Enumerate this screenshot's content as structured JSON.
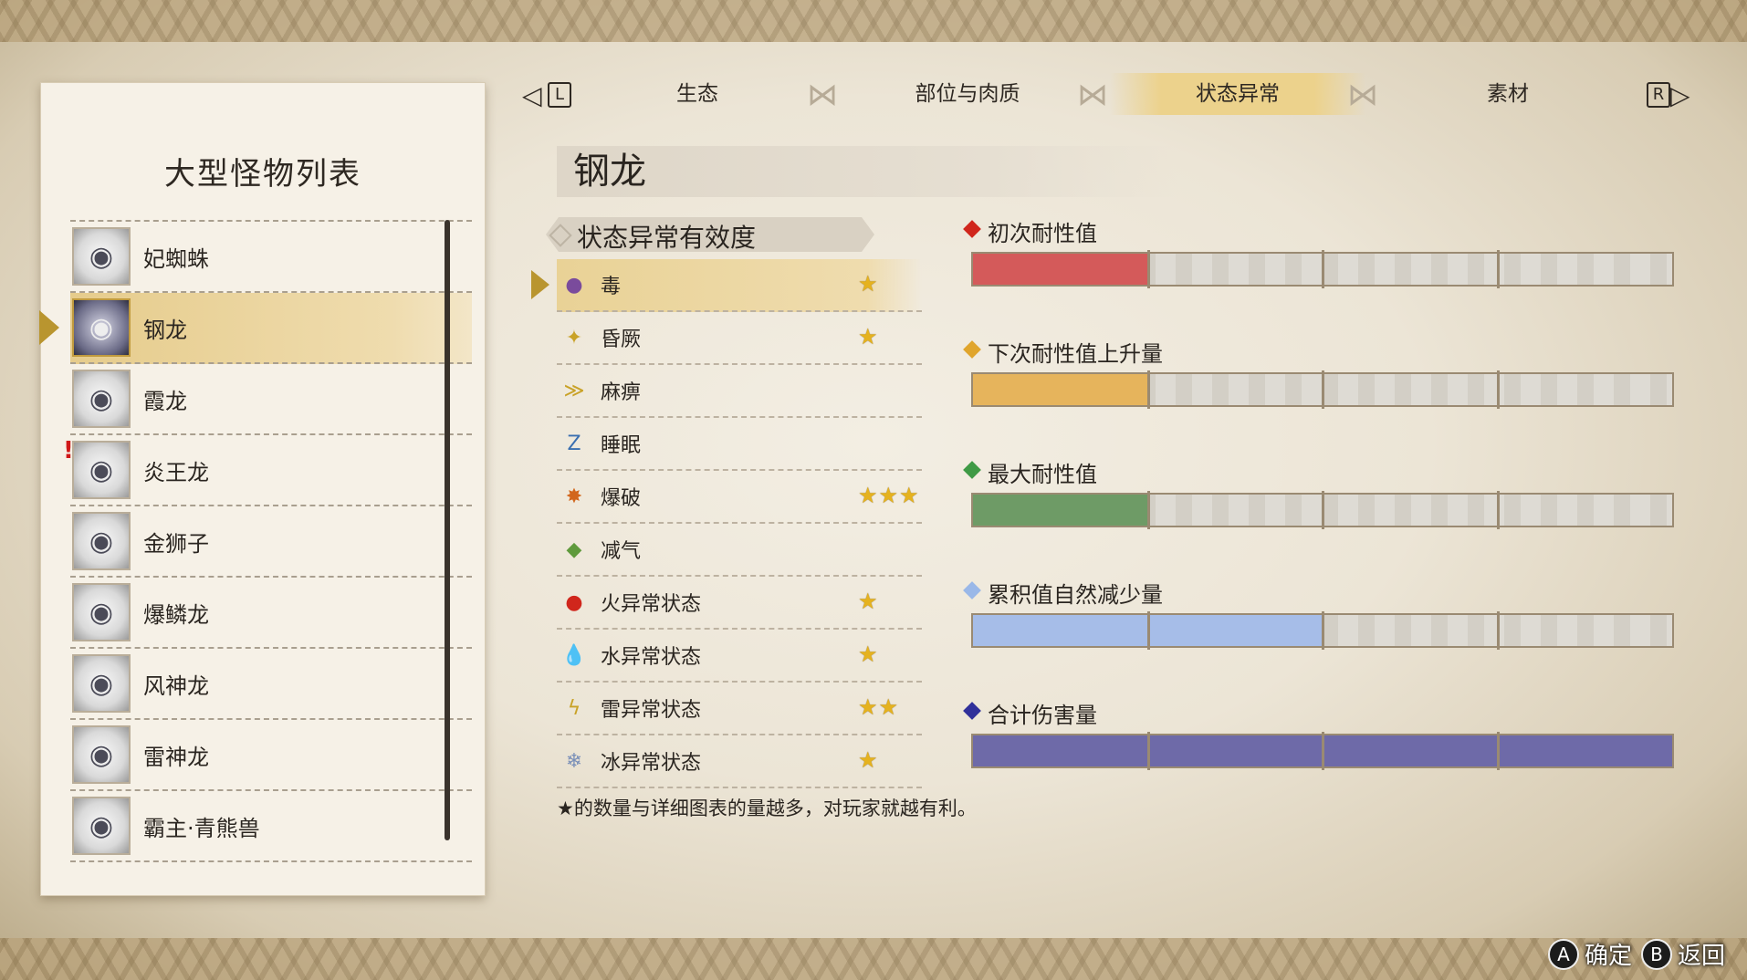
{
  "left_panel": {
    "title": "大型怪物列表",
    "monsters": [
      {
        "name": "妃蜘蛛",
        "alert": false
      },
      {
        "name": "钢龙",
        "alert": false,
        "selected": true
      },
      {
        "name": "霞龙",
        "alert": false
      },
      {
        "name": "炎王龙",
        "alert": true,
        "alert_text": "!"
      },
      {
        "name": "金狮子",
        "alert": false
      },
      {
        "name": "爆鳞龙",
        "alert": false
      },
      {
        "name": "风神龙",
        "alert": false
      },
      {
        "name": "雷神龙",
        "alert": false
      },
      {
        "name": "霸主·青熊兽",
        "alert": false
      }
    ]
  },
  "tabs": {
    "left_key": "L",
    "right_key": "R",
    "items": [
      "生态",
      "部位与肉质",
      "状态异常",
      "素材"
    ],
    "active_index": 2
  },
  "monster_title": "钢龙",
  "effectiveness": {
    "header": "状态异常有效度",
    "ailments": [
      {
        "name": "毒",
        "stars": "★",
        "icon": "poison-icon",
        "glyph": "●",
        "color": "#7a4b9c",
        "selected": true
      },
      {
        "name": "昏厥",
        "stars": "★",
        "icon": "stun-icon",
        "glyph": "✦",
        "color": "#c9a227"
      },
      {
        "name": "麻痹",
        "stars": "",
        "icon": "paralysis-icon",
        "glyph": "≫",
        "color": "#c9a227"
      },
      {
        "name": "睡眠",
        "stars": "",
        "icon": "sleep-icon",
        "glyph": "Z",
        "color": "#3a6fb0"
      },
      {
        "name": "爆破",
        "stars": "★★★",
        "icon": "blast-icon",
        "glyph": "✸",
        "color": "#d2661c"
      },
      {
        "name": "减气",
        "stars": "",
        "icon": "exhaust-icon",
        "glyph": "◆",
        "color": "#5f9a3c"
      },
      {
        "name": "火异常状态",
        "stars": "★",
        "icon": "fire-icon",
        "glyph": "●",
        "color": "#d0261c"
      },
      {
        "name": "水异常状态",
        "stars": "★",
        "icon": "water-icon",
        "glyph": "💧",
        "color": "#3d8ad6"
      },
      {
        "name": "雷异常状态",
        "stars": "★★",
        "icon": "thunder-icon",
        "glyph": "ϟ",
        "color": "#c9a227"
      },
      {
        "name": "冰异常状态",
        "stars": "★",
        "icon": "ice-icon",
        "glyph": "❄",
        "color": "#7a8fb8"
      }
    ],
    "footnote": "★的数量与详细图表的量越多，对玩家就越有利。"
  },
  "stats": [
    {
      "label": "初次耐性值",
      "diamond_color": "#d0261c",
      "fill_color": "#d45a5a",
      "level": 0.25
    },
    {
      "label": "下次耐性值上升量",
      "diamond_color": "#e0a52c",
      "fill_color": "#e6b45c",
      "level": 0.25
    },
    {
      "label": "最大耐性值",
      "diamond_color": "#3f9a45",
      "fill_color": "#6e9b66",
      "level": 0.25
    },
    {
      "label": "累积值自然减少量",
      "diamond_color": "#9ab8e8",
      "fill_color": "#a6bde8",
      "level": 0.5
    },
    {
      "label": "合计伤害量",
      "diamond_color": "#30309a",
      "fill_color": "#6e6aa8",
      "level": 1.0
    }
  ],
  "buttons": {
    "confirm_key": "A",
    "confirm_label": "确定",
    "back_key": "B",
    "back_label": "返回"
  }
}
